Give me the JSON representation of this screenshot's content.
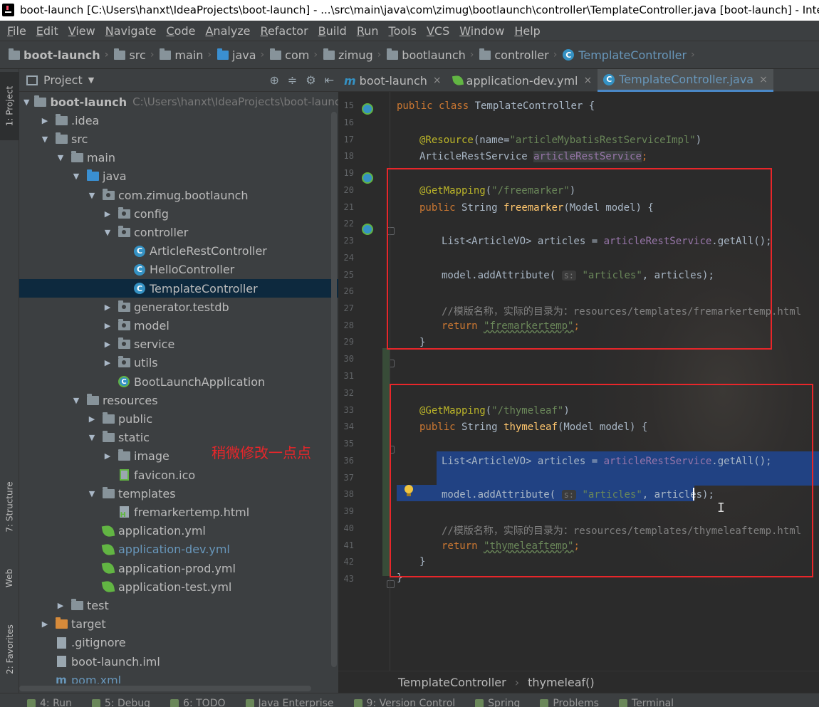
{
  "window": {
    "title": "boot-launch [C:\\Users\\hanxt\\IdeaProjects\\boot-launch] - ...\\src\\main\\java\\com\\zimug\\bootlaunch\\controller\\TemplateController.java [boot-launch] - IntelliJ IDEA"
  },
  "menu": [
    "File",
    "Edit",
    "View",
    "Navigate",
    "Code",
    "Analyze",
    "Refactor",
    "Build",
    "Run",
    "Tools",
    "VCS",
    "Window",
    "Help"
  ],
  "breadcrumbs": [
    "boot-launch",
    "src",
    "main",
    "java",
    "com",
    "zimug",
    "bootlaunch",
    "controller",
    "TemplateController"
  ],
  "left_strip": {
    "project_tab": "1: Project",
    "structure_tab": "7: Structure",
    "web_tab": "Web",
    "favorites_tab": "2: Favorites"
  },
  "project_panel": {
    "title": "Project",
    "root_path": "C:\\Users\\hanxt\\IdeaProjects\\boot-launch",
    "tree": [
      {
        "label": "boot-launch",
        "depth": 0,
        "arrow": "down",
        "icon": "folder",
        "bold": true
      },
      {
        "label": ".idea",
        "depth": 1,
        "arrow": "right",
        "icon": "folder"
      },
      {
        "label": "src",
        "depth": 1,
        "arrow": "down",
        "icon": "folder"
      },
      {
        "label": "main",
        "depth": 2,
        "arrow": "down",
        "icon": "folder"
      },
      {
        "label": "java",
        "depth": 3,
        "arrow": "down",
        "icon": "folder-blue"
      },
      {
        "label": "com.zimug.bootlaunch",
        "depth": 4,
        "arrow": "down",
        "icon": "package"
      },
      {
        "label": "config",
        "depth": 5,
        "arrow": "right",
        "icon": "package"
      },
      {
        "label": "controller",
        "depth": 5,
        "arrow": "down",
        "icon": "package"
      },
      {
        "label": "ArticleRestController",
        "depth": 6,
        "arrow": "none",
        "icon": "class"
      },
      {
        "label": "HelloController",
        "depth": 6,
        "arrow": "none",
        "icon": "class"
      },
      {
        "label": "TemplateController",
        "depth": 6,
        "arrow": "none",
        "icon": "class",
        "selected": true
      },
      {
        "label": "generator.testdb",
        "depth": 5,
        "arrow": "right",
        "icon": "package"
      },
      {
        "label": "model",
        "depth": 5,
        "arrow": "right",
        "icon": "package"
      },
      {
        "label": "service",
        "depth": 5,
        "arrow": "right",
        "icon": "package"
      },
      {
        "label": "utils",
        "depth": 5,
        "arrow": "right",
        "icon": "package"
      },
      {
        "label": "BootLaunchApplication",
        "depth": 5,
        "arrow": "none",
        "icon": "app-class"
      },
      {
        "label": "resources",
        "depth": 3,
        "arrow": "down",
        "icon": "folder"
      },
      {
        "label": "public",
        "depth": 4,
        "arrow": "right",
        "icon": "folder"
      },
      {
        "label": "static",
        "depth": 4,
        "arrow": "down",
        "icon": "folder"
      },
      {
        "label": "image",
        "depth": 5,
        "arrow": "right",
        "icon": "folder"
      },
      {
        "label": "favicon.ico",
        "depth": 5,
        "arrow": "none",
        "icon": "file-ico"
      },
      {
        "label": "templates",
        "depth": 4,
        "arrow": "down",
        "icon": "folder"
      },
      {
        "label": "fremarkertemp.html",
        "depth": 5,
        "arrow": "none",
        "icon": "file-html"
      },
      {
        "label": "application.yml",
        "depth": 4,
        "arrow": "none",
        "icon": "spring-leaf"
      },
      {
        "label": "application-dev.yml",
        "depth": 4,
        "arrow": "none",
        "icon": "spring-leaf",
        "blue": true
      },
      {
        "label": "application-prod.yml",
        "depth": 4,
        "arrow": "none",
        "icon": "spring-leaf"
      },
      {
        "label": "application-test.yml",
        "depth": 4,
        "arrow": "none",
        "icon": "spring-leaf"
      },
      {
        "label": "test",
        "depth": 2,
        "arrow": "right",
        "icon": "folder"
      },
      {
        "label": "target",
        "depth": 1,
        "arrow": "right",
        "icon": "folder-orange"
      },
      {
        "label": ".gitignore",
        "depth": 1,
        "arrow": "none",
        "icon": "file-doc"
      },
      {
        "label": "boot-launch.iml",
        "depth": 1,
        "arrow": "none",
        "icon": "file-doc"
      },
      {
        "label": "pom.xml",
        "depth": 1,
        "arrow": "none",
        "icon": "maven",
        "blue": true
      }
    ]
  },
  "annotation_text": "稍微修改一点点",
  "editor": {
    "tabs": [
      {
        "label": "boot-launch",
        "icon": "maven",
        "active": false
      },
      {
        "label": "application-dev.yml",
        "icon": "spring-leaf",
        "active": false
      },
      {
        "label": "TemplateController.java",
        "icon": "class",
        "active": true
      }
    ],
    "line_numbers": [
      "15",
      "16",
      "17",
      "18",
      "19",
      "20",
      "21",
      "22",
      "23",
      "24",
      "25",
      "26",
      "27",
      "28",
      "29",
      "30",
      "31",
      "32",
      "33",
      "34",
      "35",
      "36",
      "37",
      "38",
      "39",
      "40",
      "41",
      "42",
      "43"
    ],
    "breadcrumb": [
      "TemplateController",
      "thymeleaf()"
    ],
    "code": {
      "l15_kw": "public class ",
      "l15_rest": "TemplateController {",
      "l17_ann": "@Resource",
      "l17_a": "(name=",
      "l17_str": "\"articleMybatisRestServiceImpl\"",
      "l17_b": ")",
      "l18_a": "ArticleRestService ",
      "l18_fld": "articleRestService",
      "l18_b": ";",
      "l20_ann": "@GetMapping",
      "l20_a": "(",
      "l20_str": "\"/freemarker\"",
      "l20_b": ")",
      "l21_kw": "public ",
      "l21_a": "String ",
      "l21_fn": "freemarker",
      "l21_b": "(Model model) {",
      "l23_a": "List<ArticleVO> articles = ",
      "l23_fld": "articleRestService",
      "l23_b": ".getAll();",
      "l25_a": "model.addAttribute( ",
      "l25_hint": "s:",
      "l25_str": " \"articles\"",
      "l25_b": ", articles);",
      "l27_cmt": "//模版名称，实际的目录为：resources/templates/fremarkertemp.html",
      "l28_kw": "return ",
      "l28_str": "\"fremarkertemp\"",
      "l28_b": ";",
      "l29": "}",
      "l33_ann": "@GetMapping",
      "l33_a": "(",
      "l33_str": "\"/thymeleaf\"",
      "l33_b": ")",
      "l34_kw": "public ",
      "l34_a": "String ",
      "l34_fn": "thymeleaf",
      "l34_b": "(Model model) {",
      "l36_a": "List<ArticleVO> articles = ",
      "l36_fld": "articleRestService",
      "l36_b": ".getAll();",
      "l38_a": "model.addAttribute( ",
      "l38_hint": "s:",
      "l38_str": " \"articles\"",
      "l38_b": ", articles);",
      "l40_cmt": "//模版名称，实际的目录为：resources/templates/thymeleaftemp.html",
      "l41_kw": "return ",
      "l41_str": "\"thymeleaftemp\"",
      "l41_b": ";",
      "l42": "}",
      "l43": "}"
    }
  },
  "bottom_tools": [
    "4: Run",
    "5: Debug",
    "6: TODO",
    "Java Enterprise",
    "9: Version Control",
    "Spring",
    "Problems",
    "Terminal"
  ]
}
